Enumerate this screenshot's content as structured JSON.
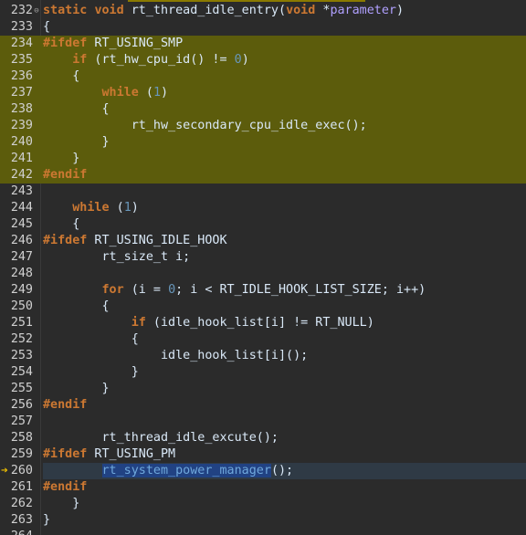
{
  "editor": {
    "current_line": 260,
    "lines": [
      {
        "n": "232",
        "fold": "⊖",
        "segs": [
          [
            "kw",
            "static"
          ],
          [
            "txt",
            " "
          ],
          [
            "kw",
            "void"
          ],
          [
            "txt",
            " rt_thread_idle_entry("
          ],
          [
            "kw",
            "void"
          ],
          [
            "txt",
            " *"
          ],
          [
            "param",
            "parameter"
          ],
          [
            "txt",
            ")"
          ]
        ]
      },
      {
        "n": "233",
        "segs": [
          [
            "txt",
            "{"
          ]
        ]
      },
      {
        "n": "234",
        "hl": true,
        "segs": [
          [
            "pp",
            "#ifdef"
          ],
          [
            "txt",
            " RT_USING_SMP"
          ]
        ]
      },
      {
        "n": "235",
        "hl": true,
        "segs": [
          [
            "txt",
            "    "
          ],
          [
            "kw",
            "if"
          ],
          [
            "txt",
            " (rt_hw_cpu_id() != "
          ],
          [
            "num",
            "0"
          ],
          [
            "txt",
            ")"
          ]
        ]
      },
      {
        "n": "236",
        "hl": true,
        "segs": [
          [
            "txt",
            "    {"
          ]
        ]
      },
      {
        "n": "237",
        "hl": true,
        "segs": [
          [
            "txt",
            "        "
          ],
          [
            "kw",
            "while"
          ],
          [
            "txt",
            " ("
          ],
          [
            "num",
            "1"
          ],
          [
            "txt",
            ")"
          ]
        ]
      },
      {
        "n": "238",
        "hl": true,
        "segs": [
          [
            "txt",
            "        {"
          ]
        ]
      },
      {
        "n": "239",
        "hl": true,
        "segs": [
          [
            "txt",
            "            rt_hw_secondary_cpu_idle_exec();"
          ]
        ]
      },
      {
        "n": "240",
        "hl": true,
        "segs": [
          [
            "txt",
            "        }"
          ]
        ]
      },
      {
        "n": "241",
        "hl": true,
        "segs": [
          [
            "txt",
            "    }"
          ]
        ]
      },
      {
        "n": "242",
        "hl": true,
        "segs": [
          [
            "pp",
            "#endif"
          ]
        ]
      },
      {
        "n": "243",
        "segs": []
      },
      {
        "n": "244",
        "segs": [
          [
            "txt",
            "    "
          ],
          [
            "kw",
            "while"
          ],
          [
            "txt",
            " ("
          ],
          [
            "num",
            "1"
          ],
          [
            "txt",
            ")"
          ]
        ]
      },
      {
        "n": "245",
        "segs": [
          [
            "txt",
            "    {"
          ]
        ]
      },
      {
        "n": "246",
        "segs": [
          [
            "pp",
            "#ifdef"
          ],
          [
            "txt",
            " RT_USING_IDLE_HOOK"
          ]
        ]
      },
      {
        "n": "247",
        "segs": [
          [
            "txt",
            "        rt_size_t i;"
          ]
        ]
      },
      {
        "n": "248",
        "segs": []
      },
      {
        "n": "249",
        "segs": [
          [
            "txt",
            "        "
          ],
          [
            "kw",
            "for"
          ],
          [
            "txt",
            " (i = "
          ],
          [
            "num",
            "0"
          ],
          [
            "txt",
            "; i < RT_IDLE_HOOK_LIST_SIZE; i++)"
          ]
        ]
      },
      {
        "n": "250",
        "segs": [
          [
            "txt",
            "        {"
          ]
        ]
      },
      {
        "n": "251",
        "segs": [
          [
            "txt",
            "            "
          ],
          [
            "kw",
            "if"
          ],
          [
            "txt",
            " (idle_hook_list[i] != RT_NULL)"
          ]
        ]
      },
      {
        "n": "252",
        "segs": [
          [
            "txt",
            "            {"
          ]
        ]
      },
      {
        "n": "253",
        "segs": [
          [
            "txt",
            "                idle_hook_list[i]();"
          ]
        ]
      },
      {
        "n": "254",
        "segs": [
          [
            "txt",
            "            }"
          ]
        ]
      },
      {
        "n": "255",
        "segs": [
          [
            "txt",
            "        }"
          ]
        ]
      },
      {
        "n": "256",
        "segs": [
          [
            "pp",
            "#endif"
          ]
        ]
      },
      {
        "n": "257",
        "segs": []
      },
      {
        "n": "258",
        "segs": [
          [
            "txt",
            "        rt_thread_idle_excute();"
          ]
        ]
      },
      {
        "n": "259",
        "segs": [
          [
            "pp",
            "#ifdef"
          ],
          [
            "txt",
            " RT_USING_PM"
          ]
        ]
      },
      {
        "n": "260",
        "cur": true,
        "segs": [
          [
            "txt",
            "        "
          ],
          [
            "sel",
            "rt_system_power_manager"
          ],
          [
            "txt",
            "();"
          ]
        ]
      },
      {
        "n": "261",
        "segs": [
          [
            "pp",
            "#endif"
          ]
        ]
      },
      {
        "n": "262",
        "segs": [
          [
            "txt",
            "    }"
          ]
        ]
      },
      {
        "n": "263",
        "segs": [
          [
            "txt",
            "}"
          ]
        ]
      },
      {
        "n": "264",
        "segs": []
      }
    ]
  },
  "colors": {
    "background": "#2b2b2b",
    "inactive_block": "#5c5c0c",
    "keyword": "#cc7832",
    "number": "#6897bb",
    "selection": "#214283",
    "breakpoint_arrow": "#f0c000"
  },
  "icons": {
    "fold": "collapse-minus-icon",
    "current_line": "instruction-pointer-arrow-icon"
  }
}
